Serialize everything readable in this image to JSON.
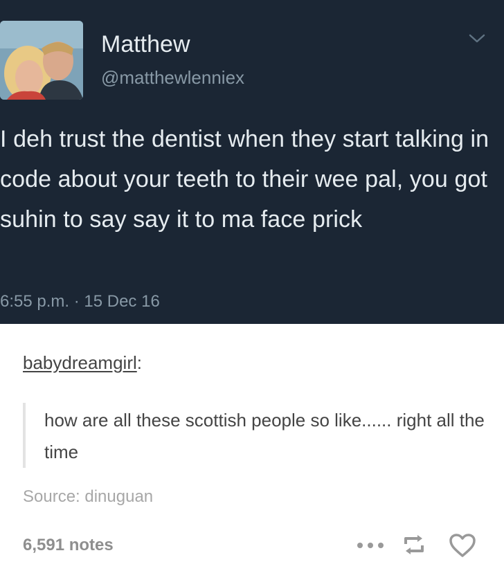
{
  "tweet": {
    "author_name": "Matthew",
    "author_handle": "@matthewlenniex",
    "text": "I deh trust the dentist when they start talking in code about your teeth to their wee pal, you got suhin to say say it to ma face prick",
    "time": "6:55 p.m. · 15 Dec 16"
  },
  "post": {
    "reblog_user": "babydreamgirl",
    "reblog_colon": ":",
    "quote_text": "how are all these scottish people so like...... right all the time",
    "source": "Source: dinuguan",
    "notes": "6,591 notes"
  },
  "icons": {
    "chevron": "chevron-down-icon",
    "more": "more-dots-icon",
    "reblog": "reblog-icon",
    "like": "heart-icon"
  },
  "colors": {
    "tweet_background": "#1b2634",
    "tweet_text": "#e6ecf0",
    "tweet_secondary": "#8899a6",
    "post_text": "#444444",
    "muted": "#a7a7a7"
  }
}
